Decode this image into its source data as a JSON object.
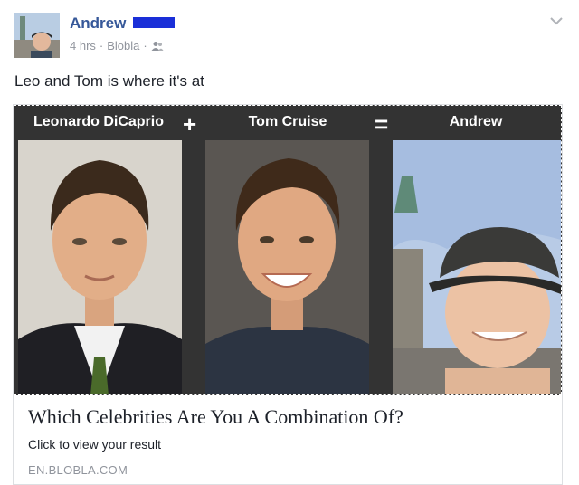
{
  "post": {
    "author": "Andrew",
    "time": "4 hrs",
    "separator": "·",
    "source": "Blobla",
    "audience_icon": "friends-icon",
    "text": "Leo and Tom is where it's at"
  },
  "banner": {
    "label_left": "Leonardo DiCaprio",
    "op_plus": "+",
    "label_middle": "Tom Cruise",
    "op_equals": "=",
    "label_right": "Andrew"
  },
  "link": {
    "title": "Which Celebrities Are You A Combination Of?",
    "description": "Click to view your result",
    "domain": "EN.BLOBLA.COM"
  },
  "colors": {
    "author_link": "#365899",
    "meta_gray": "#90949c",
    "banner_bg": "#333333",
    "redaction": "#1a2fd8"
  }
}
